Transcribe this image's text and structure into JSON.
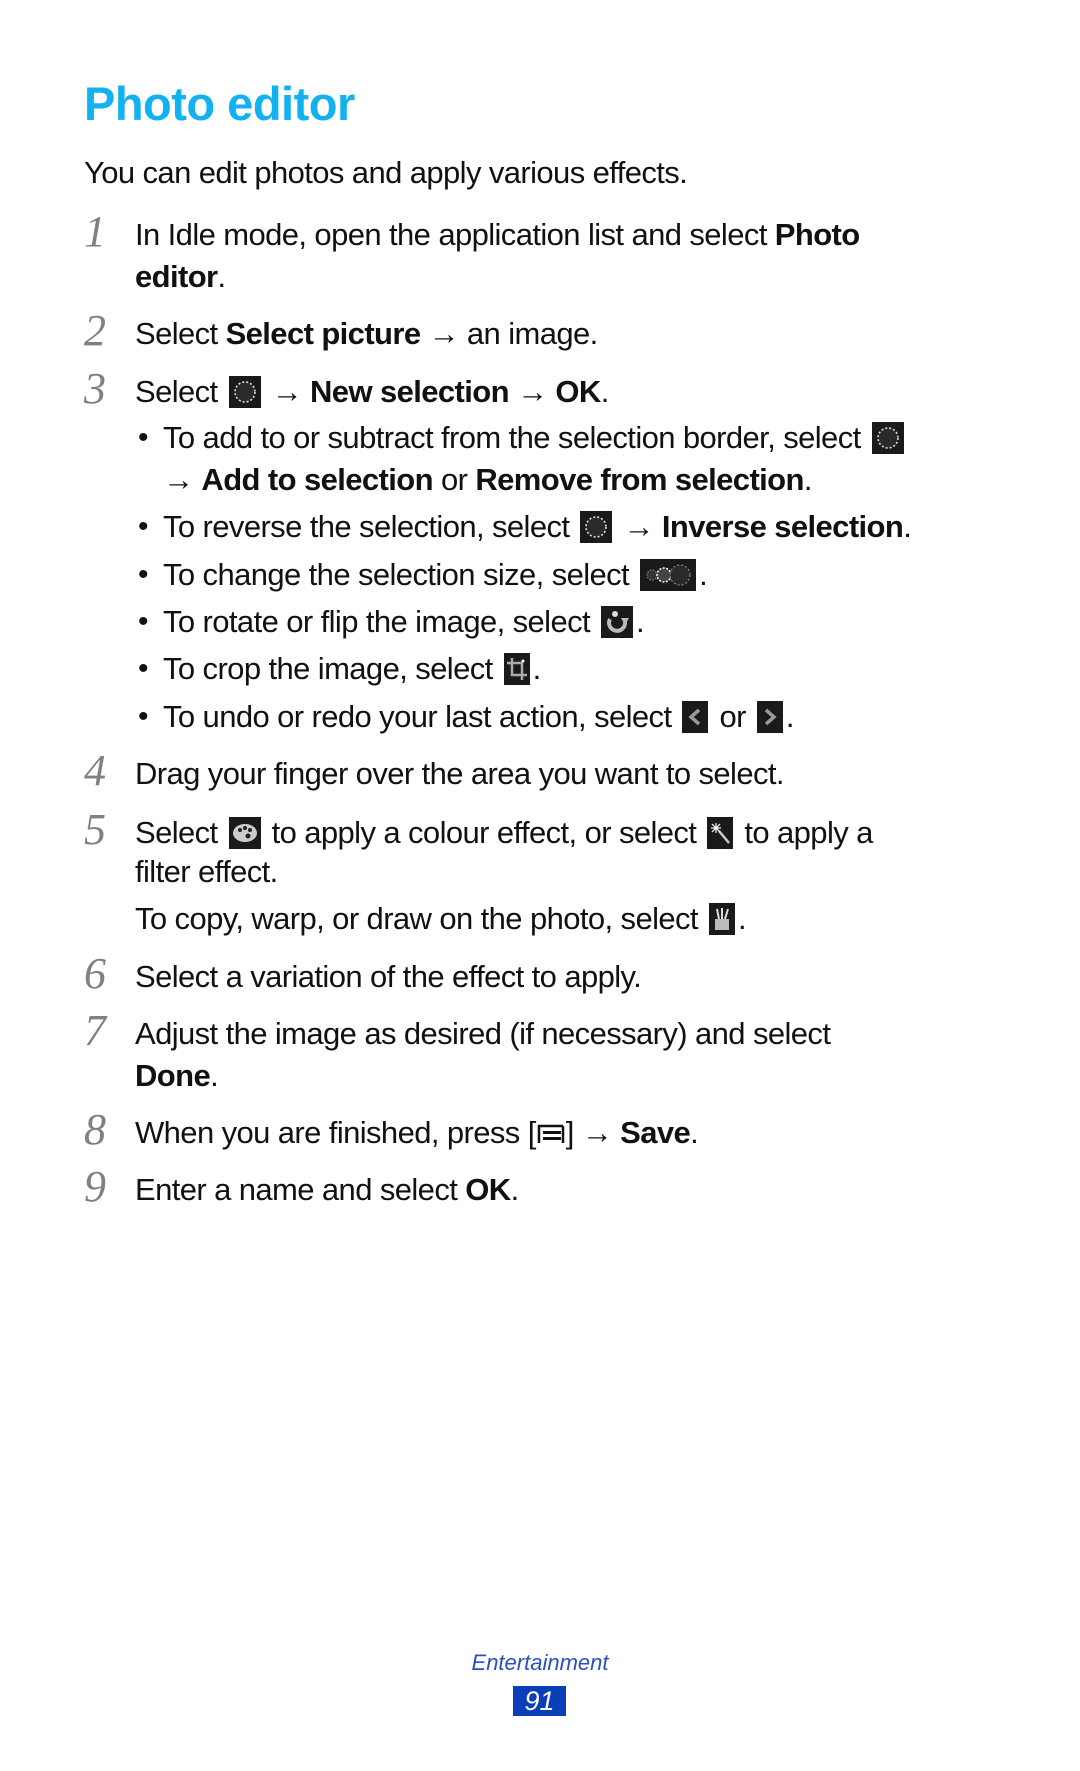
{
  "page": {
    "title": "Photo editor",
    "intro": "You can edit photos and apply various effects.",
    "title_color": "#12b1f0"
  },
  "steps": [
    {
      "num": "1",
      "l1_a": "In Idle mode, open the application list and select ",
      "l1_b": "Photo",
      "l2_b": "editor",
      "l2_c": "."
    },
    {
      "num": "2",
      "a": "Select ",
      "b": "Select picture",
      "c": " → an image."
    },
    {
      "num": "3",
      "a": "Select ",
      "icon": "selection-icon",
      "c": " → ",
      "d": "New selection",
      "e": " → ",
      "f": "OK",
      "g": ".",
      "bullets": [
        {
          "a": "To add to or subtract from the selection border, select ",
          "icon": "selection-icon",
          "b2_a": "→ ",
          "b2_b": "Add to selection",
          "b2_c": " or ",
          "b2_d": "Remove from selection",
          "b2_e": "."
        },
        {
          "a": "To reverse the selection, select ",
          "icon": "selection-icon",
          "b": " → ",
          "c": "Inverse selection",
          "d": "."
        },
        {
          "a": "To change the selection size, select ",
          "icon": "selection-size-icon",
          "b": "."
        },
        {
          "a": "To rotate or flip the image, select ",
          "icon": "rotate-icon",
          "b": "."
        },
        {
          "a": "To crop the image, select ",
          "icon": "crop-icon",
          "b": "."
        },
        {
          "a": "To undo or redo your last action, select ",
          "icon1": "undo-icon",
          "b": " or ",
          "icon2": "redo-icon",
          "c": "."
        }
      ]
    },
    {
      "num": "4",
      "a": "Drag your finger over the area you want to select."
    },
    {
      "num": "5",
      "a": "Select ",
      "icon1": "palette-icon",
      "b": " to apply a colour effect, or select ",
      "icon2": "magic-wand-icon",
      "c": " to apply a",
      "l2": "filter effect.",
      "l3_a": "To copy, warp, or draw on the photo, select ",
      "icon3": "tools-icon",
      "l3_b": "."
    },
    {
      "num": "6",
      "a": "Select a variation of the effect to apply."
    },
    {
      "num": "7",
      "a": "Adjust the image as desired (if necessary) and select",
      "l2_b": "Done",
      "l2_c": "."
    },
    {
      "num": "8",
      "a": "When you are finished, press [",
      "icon": "menu-key-icon",
      "b": "] → ",
      "c": "Save",
      "d": "."
    },
    {
      "num": "9",
      "a": "Enter a name and select ",
      "b": "OK",
      "c": "."
    }
  ],
  "footer": {
    "section": "Entertainment",
    "page_number": "91",
    "page_number_bg": "#0a3fb8"
  }
}
